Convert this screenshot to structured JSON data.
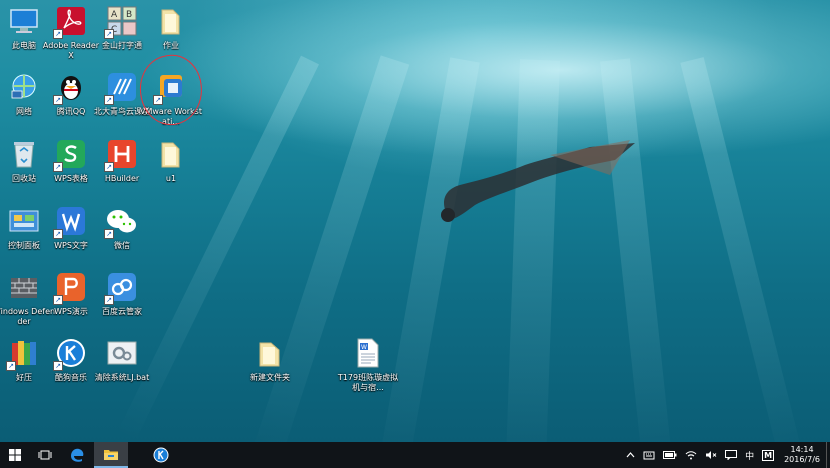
{
  "desktop": {
    "icons": [
      {
        "label": "此电脑"
      },
      {
        "label": "Adobe Reader X"
      },
      {
        "label": "金山打字通"
      },
      {
        "label": "作业"
      },
      {
        "label": "网络"
      },
      {
        "label": "腾讯QQ"
      },
      {
        "label": "北大青鸟云课堂"
      },
      {
        "label": "VMware Workstati..."
      },
      {
        "label": "回收站"
      },
      {
        "label": "WPS表格"
      },
      {
        "label": "HBuilder"
      },
      {
        "label": "u1"
      },
      {
        "label": "控制面板"
      },
      {
        "label": "WPS文字"
      },
      {
        "label": "微信"
      },
      {
        "label": "Windows Defender"
      },
      {
        "label": "WPS演示"
      },
      {
        "label": "百度云管家"
      },
      {
        "label": "好压"
      },
      {
        "label": "酷狗音乐"
      },
      {
        "label": "清除系统LJ.bat"
      },
      {
        "label": "新建文件夹"
      },
      {
        "label": "T179班陈璇虚拟机与宿..."
      }
    ]
  },
  "taskbar": {
    "tray": {
      "input_language": "中",
      "ime_label": "M",
      "time": "14:14",
      "date": "2016/7/6"
    }
  },
  "colors": {
    "taskbar_bg": "#101418",
    "annotation_circle": "#e8323c",
    "accent_blue": "#1a5fb4"
  }
}
